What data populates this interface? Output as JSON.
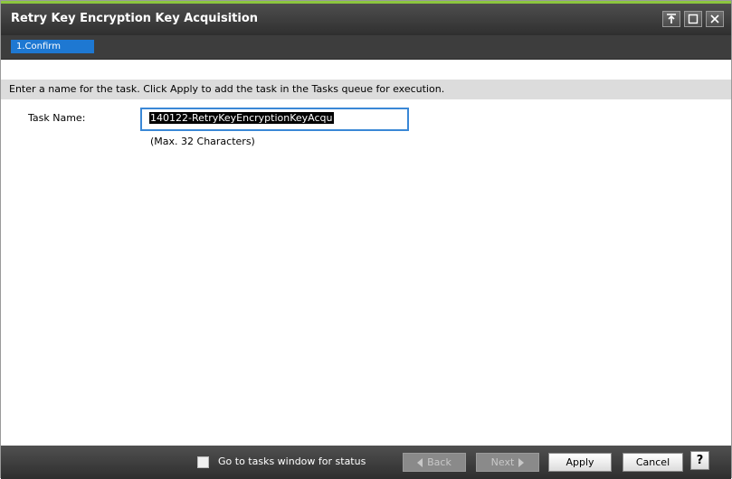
{
  "window": {
    "title": "Retry Key Encryption Key Acquisition",
    "controls": [
      "pin-icon",
      "restore-icon",
      "close-icon"
    ]
  },
  "steps": [
    {
      "label": "1.Confirm",
      "active": true
    }
  ],
  "instruction": "Enter a name for the task. Click Apply to add the task in the Tasks queue for execution.",
  "form": {
    "task_name_label": "Task Name:",
    "task_name_value": "140122-RetryKeyEncryptionKeyAcqu",
    "task_name_hint": "(Max. 32 Characters)"
  },
  "footer": {
    "checkbox_label": "Go to tasks window for status",
    "checkbox_checked": false,
    "back_label": "Back",
    "next_label": "Next",
    "apply_label": "Apply",
    "cancel_label": "Cancel",
    "help_label": "?"
  },
  "colors": {
    "accent": "#8cc63f",
    "step_active": "#1e78d2",
    "input_border": "#3a88d6"
  }
}
